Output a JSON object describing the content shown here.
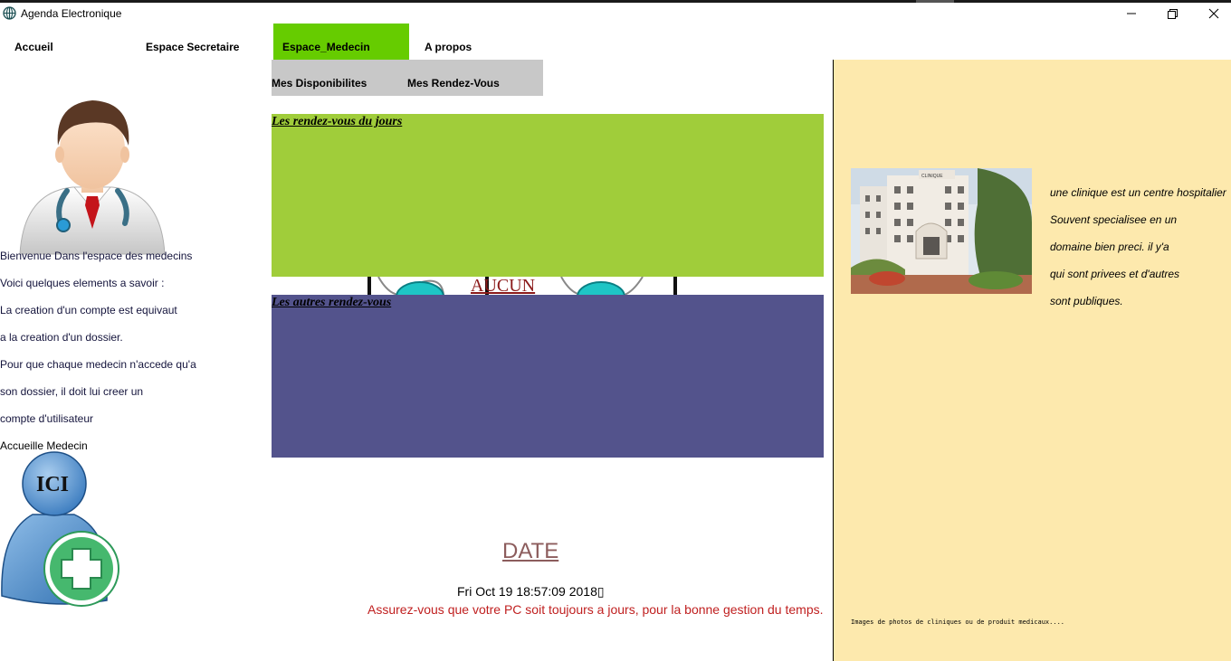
{
  "window": {
    "title": "Agenda Electronique",
    "controls": {
      "minimize": "—",
      "maximize": "❐",
      "close": "✕"
    }
  },
  "menu": {
    "items": [
      {
        "label": "Accueil"
      },
      {
        "label": "Espace Secretaire"
      },
      {
        "label": "Espace_Medecin",
        "active": true
      },
      {
        "label": "A propos"
      }
    ],
    "active_color": "#66cc00"
  },
  "submenu": {
    "items": [
      {
        "label": "Mes Disponibilites"
      },
      {
        "label": "Mes Rendez-Vous"
      }
    ]
  },
  "left": {
    "lines": [
      "Bienvenue Dans l'espace des medecins",
      "Voici quelques elements a savoir :",
      " La creation d'un compte est equivaut",
      "a la creation d'un dossier.",
      "Pour que chaque medecin n'accede qu'a",
      "son dossier, il doit lui creer un",
      "compte d'utilisateur",
      "Accueille Medecin"
    ],
    "ici_label": "ICI"
  },
  "main": {
    "today_title": "Les rendez-vous du jours",
    "today_color": "#a0cd3a",
    "others_title": "Les autres rendez-vous",
    "others_color": "#53538c",
    "empty_label": "AUCUN",
    "date_link": "DATE",
    "datetime": "Fri Oct 19 18:57:09 2018▯",
    "warning": "Assurez-vous que votre PC soit toujours a jours, pour la bonne gestion du temps."
  },
  "right": {
    "clinic_sign": "CLINIQUE",
    "lines": [
      "une clinique est un centre hospitalier",
      "Souvent specialisee en un",
      "domaine bien preci. il y'a",
      "qui sont privees et d'autres",
      " sont publiques."
    ],
    "caption": "Images de photos de cliniques ou de produit medicaux....",
    "background": "#fde9ad"
  }
}
